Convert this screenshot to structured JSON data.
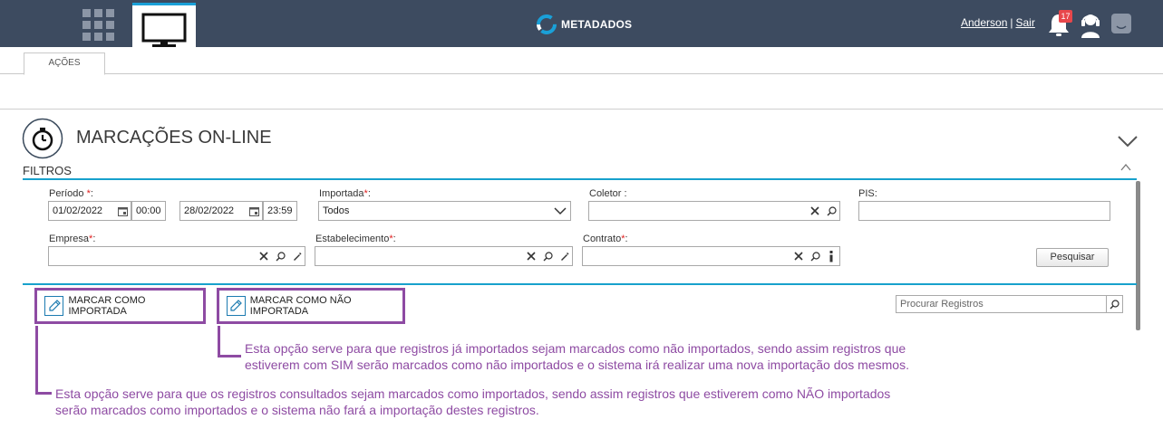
{
  "topbar": {
    "logo_text": "METADADOS",
    "user_name": "Anderson",
    "separator": "|",
    "logout_label": "Sair",
    "notification_count": "17",
    "bg_color": "#3d4b60",
    "accent_color": "#1aa0d8"
  },
  "tabs": [
    {
      "label": "AÇÕES"
    }
  ],
  "page": {
    "title": "MARCAÇÕES ON-LINE"
  },
  "filters": {
    "section_label": "FILTROS",
    "periodo": {
      "label": "Período",
      "req": "*",
      "colon": ":",
      "start_date": "01/02/2022",
      "start_time": "00:00",
      "end_date": "28/02/2022",
      "end_time": "23:59"
    },
    "importada": {
      "label": "Importada",
      "req": "*",
      "colon": ":",
      "value": "Todos"
    },
    "coletor": {
      "label": "Coletor :",
      "value": ""
    },
    "pis": {
      "label": "PIS:",
      "value": ""
    },
    "empresa": {
      "label": "Empresa",
      "req": "*",
      "colon": ":",
      "value": ""
    },
    "estabelecimento": {
      "label": "Estabelecimento",
      "req": "*",
      "colon": ":",
      "value": ""
    },
    "contrato": {
      "label": "Contrato",
      "req": "*",
      "colon": ":",
      "value": ""
    },
    "search_button": "Pesquisar"
  },
  "actions": {
    "mark_imported": "MARCAR COMO IMPORTADA",
    "mark_not_imported": "MARCAR COMO NÃO IMPORTADA",
    "search_placeholder": "Procurar Registros"
  },
  "annotations": {
    "not_imported_line1": "Esta opção serve para que registros já importados sejam marcados como não importados, sendo assim registros que",
    "not_imported_line2": "estiverem com SIM serão marcados como não importados e o sistema irá realizar uma nova importação dos mesmos.",
    "imported_line1": "Esta opção serve para que os registros consultados sejam marcados como importados, sendo assim registros que estiverem como NÃO importados",
    "imported_line2": "serão marcados como importados e o sistema não fará a importação destes registros.",
    "color": "#8e4ba3"
  }
}
